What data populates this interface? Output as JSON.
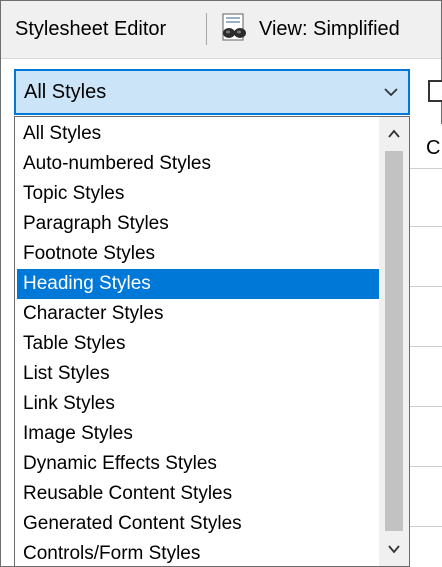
{
  "toolbar": {
    "title": "Stylesheet Editor",
    "view_label": "View: Simplified",
    "view_icon": "eye-glasses-icon"
  },
  "combo": {
    "value": "All Styles",
    "chevron_icon": "chevron-down-icon"
  },
  "grid": {
    "column_header_partial": "C"
  },
  "dropdown": {
    "selected_index": 5,
    "items": [
      "All Styles",
      "Auto-numbered Styles",
      "Topic Styles",
      "Paragraph Styles",
      "Footnote Styles",
      "Heading Styles",
      "Character Styles",
      "Table Styles",
      "List Styles",
      "Link Styles",
      "Image Styles",
      "Dynamic Effects Styles",
      "Reusable Content Styles",
      "Generated Content Styles",
      "Controls/Form Styles"
    ]
  },
  "colors": {
    "accent": "#0078d7",
    "combo_bg": "#cce4f7",
    "toolbar_bg": "#f0f0f0",
    "scroll_thumb": "#c2c2c2"
  }
}
